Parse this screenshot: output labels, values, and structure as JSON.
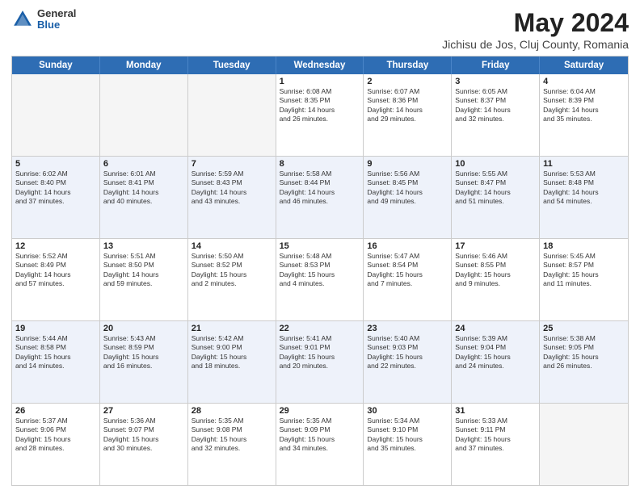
{
  "header": {
    "logo_general": "General",
    "logo_blue": "Blue",
    "title": "May 2024",
    "location": "Jichisu de Jos, Cluj County, Romania"
  },
  "weekdays": [
    "Sunday",
    "Monday",
    "Tuesday",
    "Wednesday",
    "Thursday",
    "Friday",
    "Saturday"
  ],
  "rows": [
    {
      "alt": false,
      "cells": [
        {
          "day": "",
          "text": ""
        },
        {
          "day": "",
          "text": ""
        },
        {
          "day": "",
          "text": ""
        },
        {
          "day": "1",
          "text": "Sunrise: 6:08 AM\nSunset: 8:35 PM\nDaylight: 14 hours\nand 26 minutes."
        },
        {
          "day": "2",
          "text": "Sunrise: 6:07 AM\nSunset: 8:36 PM\nDaylight: 14 hours\nand 29 minutes."
        },
        {
          "day": "3",
          "text": "Sunrise: 6:05 AM\nSunset: 8:37 PM\nDaylight: 14 hours\nand 32 minutes."
        },
        {
          "day": "4",
          "text": "Sunrise: 6:04 AM\nSunset: 8:39 PM\nDaylight: 14 hours\nand 35 minutes."
        }
      ]
    },
    {
      "alt": true,
      "cells": [
        {
          "day": "5",
          "text": "Sunrise: 6:02 AM\nSunset: 8:40 PM\nDaylight: 14 hours\nand 37 minutes."
        },
        {
          "day": "6",
          "text": "Sunrise: 6:01 AM\nSunset: 8:41 PM\nDaylight: 14 hours\nand 40 minutes."
        },
        {
          "day": "7",
          "text": "Sunrise: 5:59 AM\nSunset: 8:43 PM\nDaylight: 14 hours\nand 43 minutes."
        },
        {
          "day": "8",
          "text": "Sunrise: 5:58 AM\nSunset: 8:44 PM\nDaylight: 14 hours\nand 46 minutes."
        },
        {
          "day": "9",
          "text": "Sunrise: 5:56 AM\nSunset: 8:45 PM\nDaylight: 14 hours\nand 49 minutes."
        },
        {
          "day": "10",
          "text": "Sunrise: 5:55 AM\nSunset: 8:47 PM\nDaylight: 14 hours\nand 51 minutes."
        },
        {
          "day": "11",
          "text": "Sunrise: 5:53 AM\nSunset: 8:48 PM\nDaylight: 14 hours\nand 54 minutes."
        }
      ]
    },
    {
      "alt": false,
      "cells": [
        {
          "day": "12",
          "text": "Sunrise: 5:52 AM\nSunset: 8:49 PM\nDaylight: 14 hours\nand 57 minutes."
        },
        {
          "day": "13",
          "text": "Sunrise: 5:51 AM\nSunset: 8:50 PM\nDaylight: 14 hours\nand 59 minutes."
        },
        {
          "day": "14",
          "text": "Sunrise: 5:50 AM\nSunset: 8:52 PM\nDaylight: 15 hours\nand 2 minutes."
        },
        {
          "day": "15",
          "text": "Sunrise: 5:48 AM\nSunset: 8:53 PM\nDaylight: 15 hours\nand 4 minutes."
        },
        {
          "day": "16",
          "text": "Sunrise: 5:47 AM\nSunset: 8:54 PM\nDaylight: 15 hours\nand 7 minutes."
        },
        {
          "day": "17",
          "text": "Sunrise: 5:46 AM\nSunset: 8:55 PM\nDaylight: 15 hours\nand 9 minutes."
        },
        {
          "day": "18",
          "text": "Sunrise: 5:45 AM\nSunset: 8:57 PM\nDaylight: 15 hours\nand 11 minutes."
        }
      ]
    },
    {
      "alt": true,
      "cells": [
        {
          "day": "19",
          "text": "Sunrise: 5:44 AM\nSunset: 8:58 PM\nDaylight: 15 hours\nand 14 minutes."
        },
        {
          "day": "20",
          "text": "Sunrise: 5:43 AM\nSunset: 8:59 PM\nDaylight: 15 hours\nand 16 minutes."
        },
        {
          "day": "21",
          "text": "Sunrise: 5:42 AM\nSunset: 9:00 PM\nDaylight: 15 hours\nand 18 minutes."
        },
        {
          "day": "22",
          "text": "Sunrise: 5:41 AM\nSunset: 9:01 PM\nDaylight: 15 hours\nand 20 minutes."
        },
        {
          "day": "23",
          "text": "Sunrise: 5:40 AM\nSunset: 9:03 PM\nDaylight: 15 hours\nand 22 minutes."
        },
        {
          "day": "24",
          "text": "Sunrise: 5:39 AM\nSunset: 9:04 PM\nDaylight: 15 hours\nand 24 minutes."
        },
        {
          "day": "25",
          "text": "Sunrise: 5:38 AM\nSunset: 9:05 PM\nDaylight: 15 hours\nand 26 minutes."
        }
      ]
    },
    {
      "alt": false,
      "cells": [
        {
          "day": "26",
          "text": "Sunrise: 5:37 AM\nSunset: 9:06 PM\nDaylight: 15 hours\nand 28 minutes."
        },
        {
          "day": "27",
          "text": "Sunrise: 5:36 AM\nSunset: 9:07 PM\nDaylight: 15 hours\nand 30 minutes."
        },
        {
          "day": "28",
          "text": "Sunrise: 5:35 AM\nSunset: 9:08 PM\nDaylight: 15 hours\nand 32 minutes."
        },
        {
          "day": "29",
          "text": "Sunrise: 5:35 AM\nSunset: 9:09 PM\nDaylight: 15 hours\nand 34 minutes."
        },
        {
          "day": "30",
          "text": "Sunrise: 5:34 AM\nSunset: 9:10 PM\nDaylight: 15 hours\nand 35 minutes."
        },
        {
          "day": "31",
          "text": "Sunrise: 5:33 AM\nSunset: 9:11 PM\nDaylight: 15 hours\nand 37 minutes."
        },
        {
          "day": "",
          "text": ""
        }
      ]
    }
  ]
}
